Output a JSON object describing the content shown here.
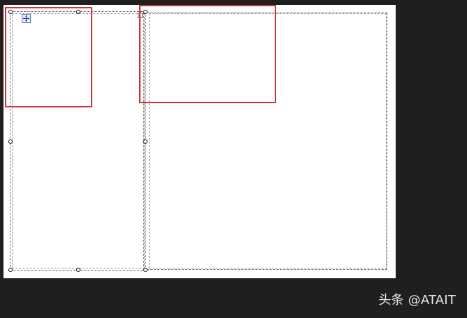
{
  "watermark": {
    "text": "头条 @ATAIT"
  },
  "colors": {
    "background": "#1f1f1f",
    "canvas": "#ffffff",
    "highlight": "#d3303b",
    "frame": "#6f6f6f"
  },
  "icons": {
    "move": "move-icon",
    "tab": "tab-icon"
  }
}
